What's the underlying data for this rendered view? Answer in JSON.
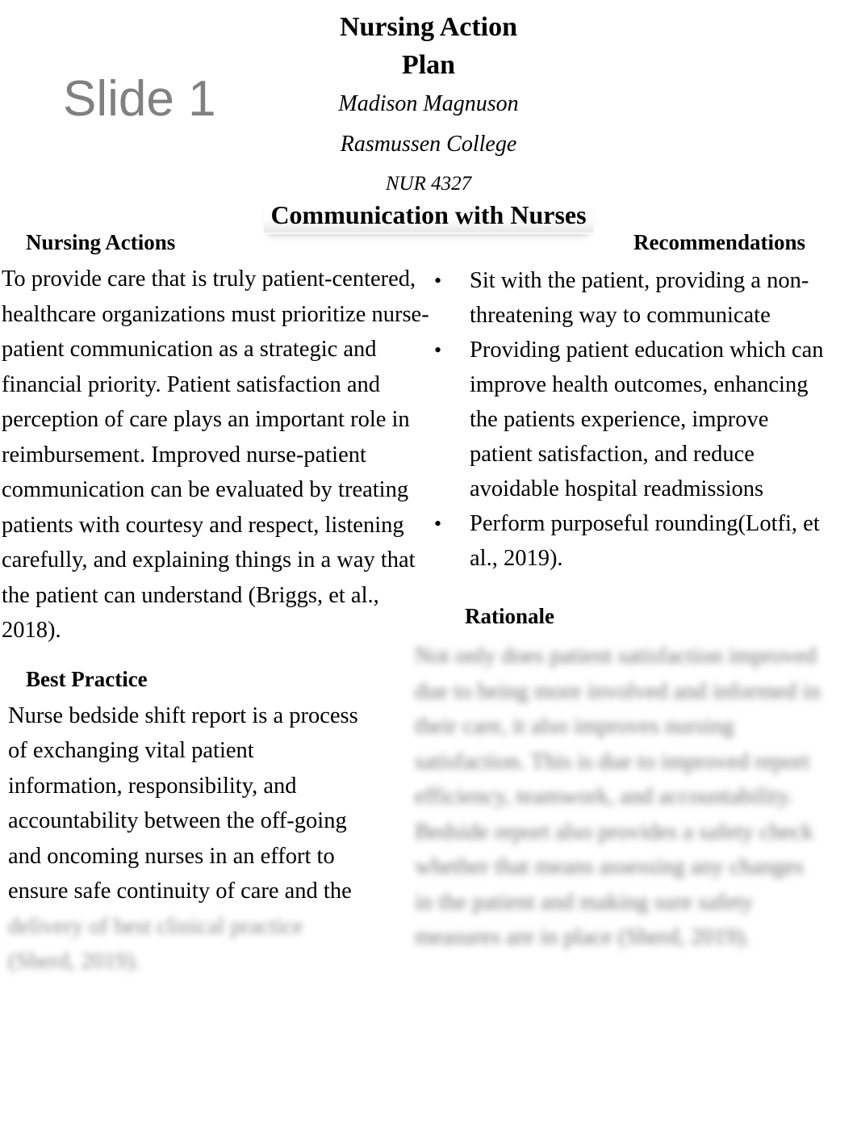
{
  "header": {
    "title_line1": "Nursing Action",
    "title_line2": "Plan",
    "author": "Madison Magnuson",
    "institution": "Rasmussen College",
    "course": "NUR 4327"
  },
  "watermark": {
    "slide_label": "Slide 1",
    "color": "#808080"
  },
  "banner": {
    "section_title": "Communication with Nurses"
  },
  "left_column": {
    "nursing_actions": {
      "heading": "Nursing Actions",
      "body": "To provide care that is truly patient-centered, healthcare organizations must prioritize nurse-patient communication as a strategic and financial priority. Patient satisfaction and perception of care plays an important role in reimbursement. Improved nurse-patient communication can be evaluated by treating patients with courtesy and respect, listening carefully, and explaining things in a way that the patient can understand (Briggs, et al., 2018)."
    },
    "best_practice": {
      "heading": "Best Practice",
      "body_visible": "Nurse bedside shift report is a process of exchanging vital patient information, responsibility, and accountability between the off-going and oncoming nurses in an effort to ensure safe continuity of care and the",
      "body_faded": "delivery of best clinical practice (Sherd, 2019)."
    }
  },
  "right_column": {
    "recommendations": {
      "heading": "Recommendations",
      "bullets": [
        "Sit with the patient, providing a non-threatening way to communicate",
        "Providing patient education which can improve health outcomes, enhancing the patients experience, improve patient satisfaction, and reduce avoidable hospital readmissions",
        "Perform purposeful rounding(Lotfi, et al., 2019)."
      ],
      "bullet_glyph": "•"
    },
    "rationale": {
      "heading": "Rationale",
      "body_blurred": "Not only does patient satisfaction improved due to being more involved and informed in their care, it also improves nursing satisfaction. This is due to improved report efficiency, teamwork, and accountability. Bedside report also provides a safety check whether that means assessing any changes in the patient and making sure safety measures are in place (Sherd, 2019)."
    }
  }
}
